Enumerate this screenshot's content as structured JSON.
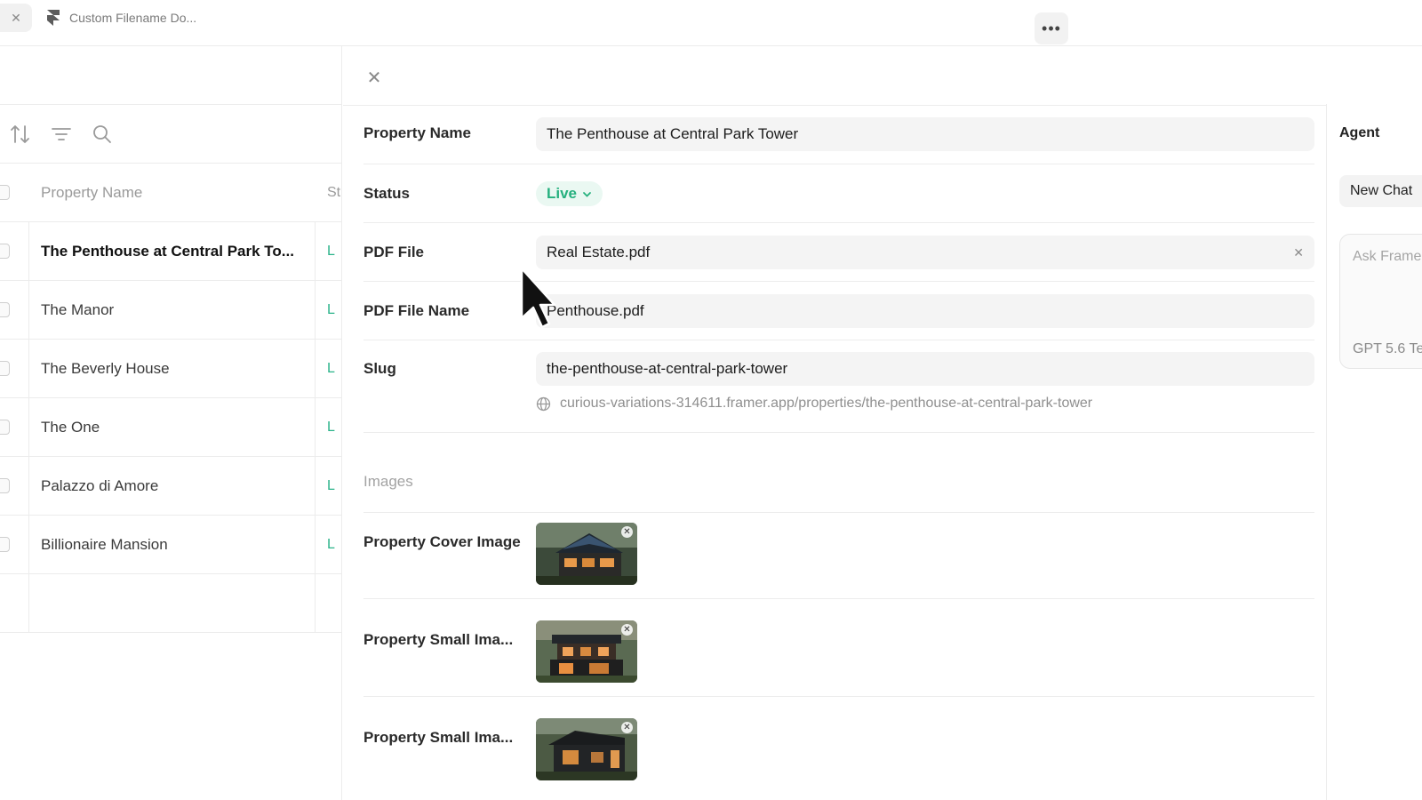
{
  "tab": {
    "title": "Custom Filename Do..."
  },
  "list": {
    "header": {
      "name": "Property Name",
      "status": "St"
    },
    "rows": [
      {
        "name": "The Penthouse at Central Park To...",
        "status": "L"
      },
      {
        "name": "The Manor",
        "status": "L"
      },
      {
        "name": "The Beverly House",
        "status": "L"
      },
      {
        "name": "The One",
        "status": "L"
      },
      {
        "name": "Palazzo di Amore",
        "status": "L"
      },
      {
        "name": "Billionaire Mansion",
        "status": "L"
      }
    ]
  },
  "editor": {
    "fields": {
      "property_name": {
        "label": "Property Name",
        "value": "The Penthouse at Central Park Tower"
      },
      "status": {
        "label": "Status",
        "value": "Live"
      },
      "pdf_file": {
        "label": "PDF File",
        "value": "Real Estate.pdf"
      },
      "pdf_file_name": {
        "label": "PDF File Name",
        "value": "Penthouse.pdf"
      },
      "slug": {
        "label": "Slug",
        "value": "the-penthouse-at-central-park-tower",
        "url": "curious-variations-314611.framer.app/properties/the-penthouse-at-central-park-tower"
      }
    },
    "images_section": "Images",
    "images": [
      {
        "label": "Property Cover Image"
      },
      {
        "label": "Property Small Ima..."
      },
      {
        "label": "Property Small Ima..."
      }
    ]
  },
  "agent": {
    "title": "Agent",
    "new_chat": "New Chat",
    "ask_placeholder": "Ask Frame",
    "model": "GPT 5.6 Te"
  },
  "colors": {
    "live_green": "#25b07e",
    "border": "#ececec",
    "input_bg": "#f4f4f4"
  }
}
